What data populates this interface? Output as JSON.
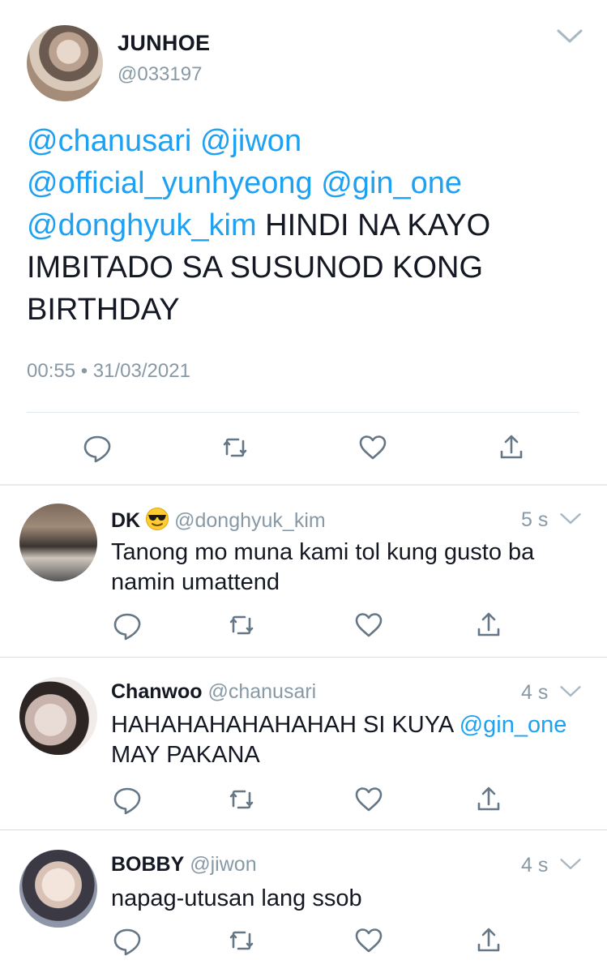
{
  "main_tweet": {
    "name": "JUNHOE",
    "handle": "@033197",
    "text_parts": [
      {
        "text": "@chanusari",
        "mention": true
      },
      {
        "text": " ",
        "mention": false
      },
      {
        "text": "@jiwon",
        "mention": true
      },
      {
        "text": " ",
        "mention": false
      },
      {
        "text": "@official_yunhyeong",
        "mention": true
      },
      {
        "text": " ",
        "mention": false
      },
      {
        "text": "@gin_one",
        "mention": true
      },
      {
        "text": " ",
        "mention": false
      },
      {
        "text": "@donghyuk_kim",
        "mention": true
      },
      {
        "text": " HINDI NA KAYO IMBITADO SA SUSUNOD KONG BIRTHDAY",
        "mention": false
      }
    ],
    "timestamp": "00:55 • 31/03/2021"
  },
  "replies": [
    {
      "name": "DK",
      "emoji": "sunglasses-emoji",
      "handle": "@donghyuk_kim",
      "time": "5 s",
      "text_parts": [
        {
          "text": "Tanong mo muna kami tol kung gusto ba namin umattend",
          "mention": false
        }
      ]
    },
    {
      "name": "Chanwoo",
      "handle": "@chanusari",
      "time": "4 s",
      "text_parts": [
        {
          "text": "HAHAHAHAHAHAHAH SI KUYA ",
          "mention": false
        },
        {
          "text": "@gin_one",
          "mention": true
        },
        {
          "text": " MAY PAKANA",
          "mention": false
        }
      ]
    },
    {
      "name": "BOBBY",
      "handle": "@jiwon",
      "time": "4 s",
      "text_parts": [
        {
          "text": "napag-utusan lang ssob",
          "mention": false
        }
      ]
    }
  ],
  "icons": {
    "reply": "reply-icon",
    "retweet": "retweet-icon",
    "like": "like-icon",
    "share": "share-icon",
    "menu": "chevron-down-icon"
  },
  "colors": {
    "mention": "#1da1f2",
    "secondary_text": "#8899a6",
    "icon": "#657786"
  }
}
